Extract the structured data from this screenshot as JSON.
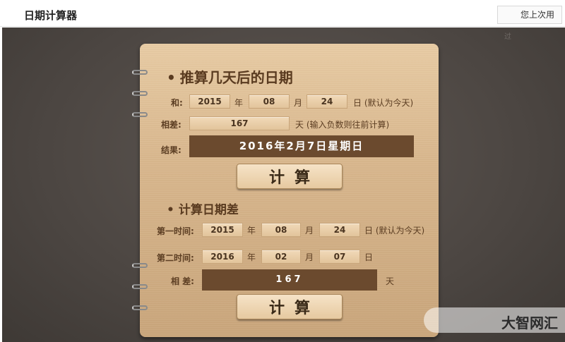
{
  "app": {
    "title": "日期计算器",
    "last_used_button": "您上次用",
    "side_text": "过"
  },
  "section1": {
    "title": "推算几天后的日期",
    "bullet": "•",
    "and_label": "和:",
    "year": "2015",
    "year_unit": "年",
    "month": "08",
    "month_unit": "月",
    "day": "24",
    "day_unit": "日 (默认为今天)",
    "diff_label": "相差:",
    "diff_value": "167",
    "diff_unit": "天 (输入负数则往前计算)",
    "result_label": "结果:",
    "result_value": "2016年2月7日星期日",
    "calc_button": "计算"
  },
  "section2": {
    "title": "计算日期差",
    "bullet": "•",
    "first_label": "第一时间:",
    "first_year": "2015",
    "first_month": "08",
    "first_day": "24",
    "first_day_unit": "日 (默认为今天)",
    "second_label": "第二时间:",
    "second_year": "2016",
    "second_month": "02",
    "second_day": "07",
    "second_day_unit": "日",
    "year_unit": "年",
    "month_unit": "月",
    "diff_label": "相 差:",
    "diff_value": "167",
    "diff_unit": "天",
    "calc_button": "计算"
  },
  "watermark": {
    "text": "大智网汇"
  }
}
